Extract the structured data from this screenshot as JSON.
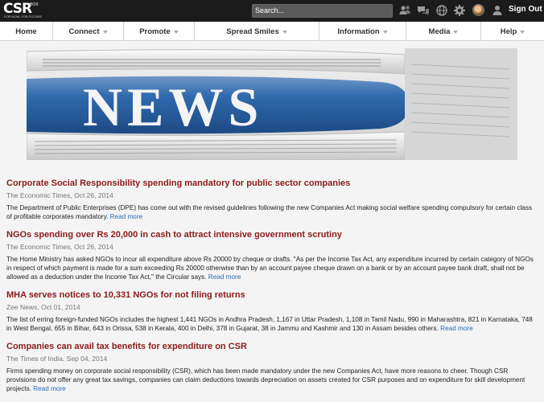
{
  "topbar": {
    "logo_text": "CSR",
    "logo_sub": "FOR NOW, FOR FUTURE",
    "logo_mark": "BOX",
    "search_placeholder": "Search...",
    "icons": [
      "users-icon",
      "messages-icon",
      "globe-icon",
      "settings-icon",
      "avatar",
      "person-icon"
    ],
    "signout_label": "Sign Out"
  },
  "nav": {
    "items": [
      {
        "label": "Home",
        "dropdown": false
      },
      {
        "label": "Connect",
        "dropdown": true
      },
      {
        "label": "Promote",
        "dropdown": true
      },
      {
        "label": "Spread Smiles",
        "dropdown": true
      },
      {
        "label": "Information",
        "dropdown": true
      },
      {
        "label": "Media",
        "dropdown": true
      },
      {
        "label": "Help",
        "dropdown": true
      }
    ]
  },
  "banner": {
    "text": "NEWS"
  },
  "articles": [
    {
      "title": "Corporate Social Responsibility spending mandatory for public sector companies",
      "source": "The Economic Times, Oct 26, 2014",
      "body": "The Department of Public Enterprises (DPE) has come out with the revised guidelines following the new Companies Act making social welfare spending compulsory for certain class of profitable corporates mandatory. ",
      "read_more": "Read more"
    },
    {
      "title": "NGOs spending over Rs 20,000 in cash to attract intensive government scrutiny",
      "source": "The Economic Times, Oct 26, 2014",
      "body": "The Home Ministry has asked NGOs to incur all expenditure above Rs 20000 by cheque or drafts. \"As per the Income Tax Act, any expenditure incurred by certain category of NGOs in respect of which payment is made for a sum exceeding Rs 20000 otherwise than by an account payee cheque drawn on a bank or by an account payee bank draft, shall not be allowed as a deduction under the Income Tax Act,\" the Circular says. ",
      "read_more": "Read more"
    },
    {
      "title": "MHA serves notices to 10,331 NGOs for not filing returns",
      "source": "Zee News, Oct 01, 2014",
      "body": "The list of erring foreign-funded NGOs includes the highest 1,441 NGOs in Andhra Pradesh, 1,167 in Uttar Pradesh, 1,108 in Tamil Nadu, 990 in Maharashtra, 821 in Karnataka, 748 in West Bengal, 655 in Bihar, 643 in Orissa, 538 in Kerala, 400 in Delhi, 378 in Gujarat, 38 in Jammu and Kashmir and 130 in Assam besides others. ",
      "read_more": "Read more"
    },
    {
      "title": "Companies can avail tax benefits for expenditure on CSR",
      "source": "The Times of India, Sep 04, 2014",
      "body": "Firms spending money on corporate social responsibility (CSR), which has been made mandatory under the new Companies Act, have more reasons to cheer. Though CSR provisions do not offer any great tax savings, companies can claim deductions towards depreciation on assets created for CSR purposes and on expenditure for skill development projects. ",
      "read_more": "Read more"
    }
  ]
}
